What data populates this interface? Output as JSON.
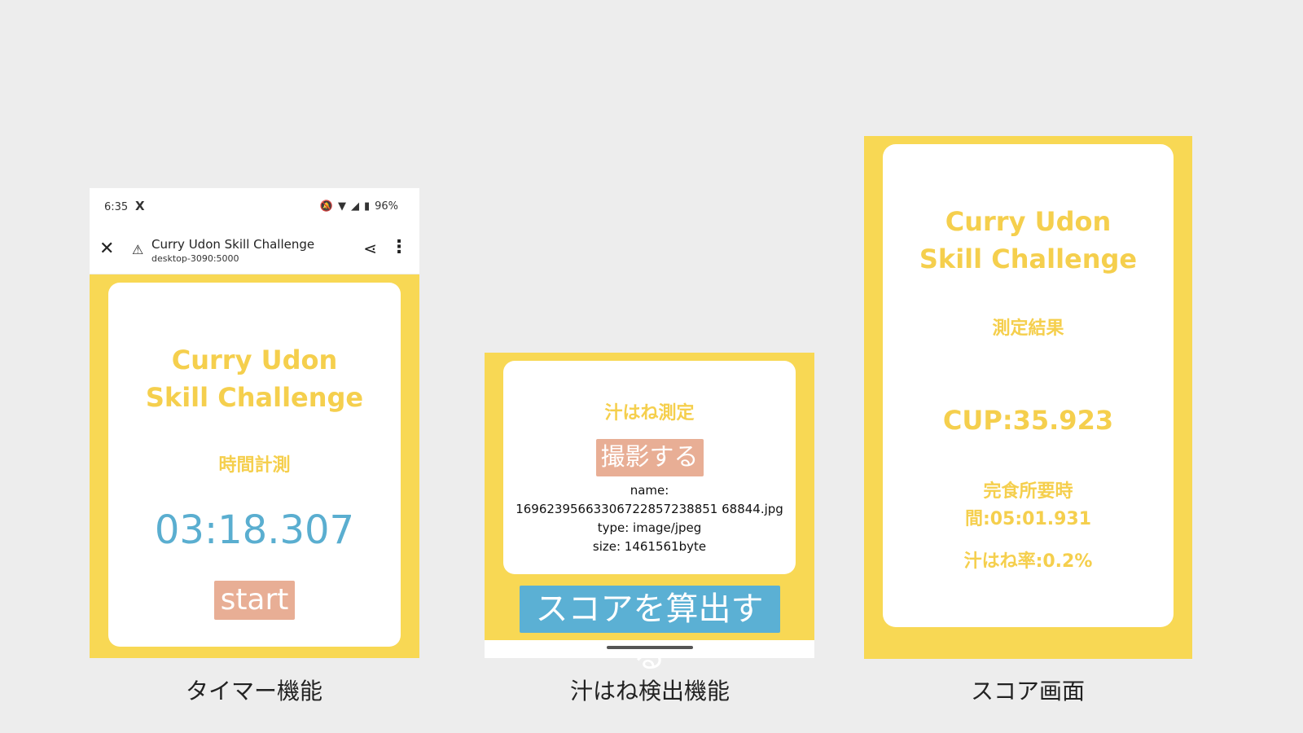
{
  "screen1": {
    "status": {
      "time": "6:35",
      "x_icon": "X",
      "battery": "96%"
    },
    "browser": {
      "title": "Curry Udon Skill Challenge",
      "url": "desktop-3090:5000"
    },
    "app_title_line1": "Curry Udon",
    "app_title_line2": "Skill Challenge",
    "section_title": "時間計測",
    "timer": "03:18.307",
    "start_label": "start",
    "caption": "タイマー機能"
  },
  "screen2": {
    "section_title": "汁はね測定",
    "capture_label": "撮影する",
    "file_name_label": "name:",
    "file_name": "16962395663306722857238851 68844.jpg",
    "file_type": "type: image/jpeg",
    "file_size": "size: 1461561byte",
    "score_button_label": "スコアを算出する",
    "caption": "汁はね検出機能"
  },
  "screen3": {
    "app_title_line1": "Curry Udon",
    "app_title_line2": "Skill Challenge",
    "section_title": "測定結果",
    "cup_score": "CUP:35.923",
    "time_label_line1": "完食所要時",
    "time_label_line2": "間:05:01.931",
    "splash_rate": "汁はね率:0.2%",
    "caption": "スコア画面"
  },
  "colors": {
    "background": "#ededed",
    "yellow": "#f8d854",
    "gold_text": "#f5cf4d",
    "timer_blue": "#5aaed0",
    "salmon": "#e8ae95",
    "button_blue": "#5bb0d4"
  },
  "icons": {
    "close": "close-icon",
    "warning": "warning-icon",
    "share": "share-icon",
    "menu": "more-vert-icon",
    "wifi": "wifi-icon",
    "signal": "signal-icon",
    "battery": "battery-icon",
    "mute": "bell-off-icon"
  }
}
